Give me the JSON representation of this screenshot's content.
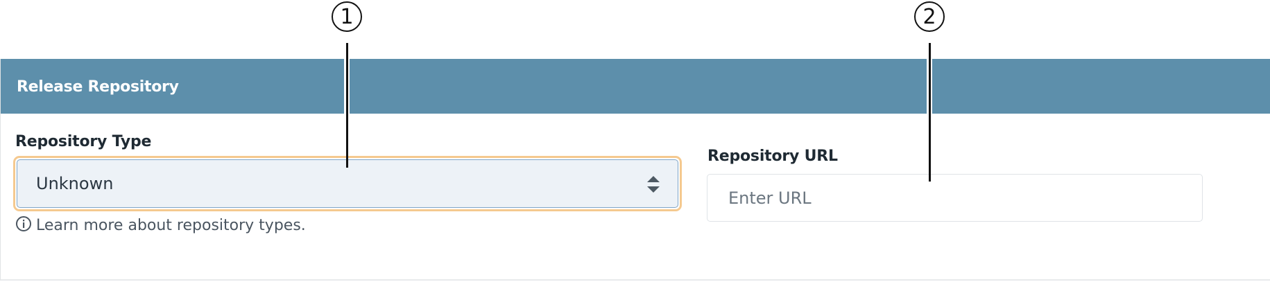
{
  "panel": {
    "title": "Release Repository"
  },
  "repository_type": {
    "label": "Repository Type",
    "selected_value": "Unknown",
    "help_icon": "info-circle-icon",
    "help_text": "Learn more about repository types."
  },
  "repository_url": {
    "label": "Repository URL",
    "placeholder": "Enter URL",
    "value": ""
  },
  "callouts": [
    {
      "number": "1"
    },
    {
      "number": "2"
    }
  ],
  "colors": {
    "header_bg": "#5d8fab",
    "header_text": "#ffffff",
    "focus_ring": "#f5c98f",
    "select_bg": "#edf2f7"
  }
}
